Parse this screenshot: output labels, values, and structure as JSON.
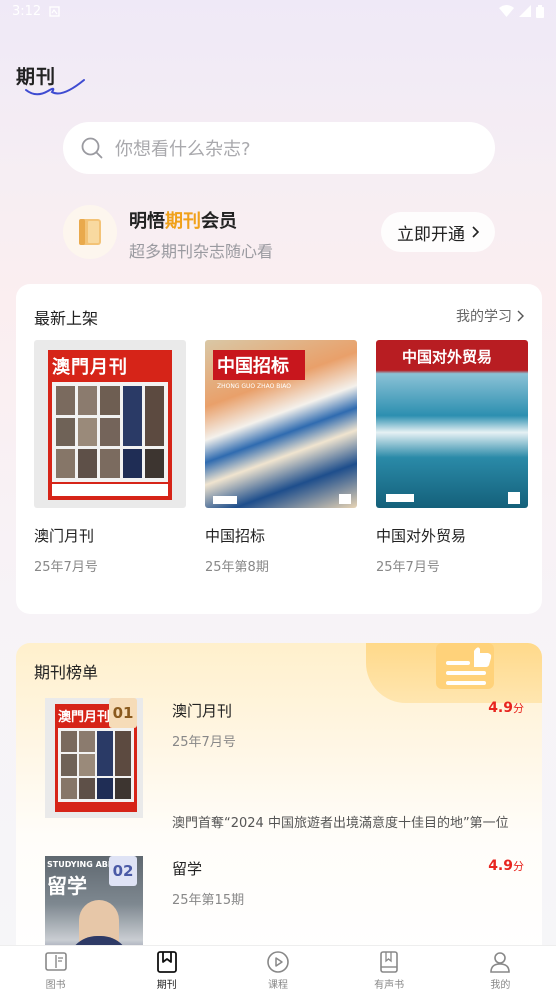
{
  "status": {
    "time": "3:12"
  },
  "page": {
    "title": "期刊"
  },
  "search": {
    "placeholder": "你想看什么杂志?"
  },
  "member": {
    "title_prefix": "明悟",
    "title_highlight": "期刊",
    "title_suffix": "会员",
    "subtitle": "超多期刊杂志随心看",
    "button": "立即开通"
  },
  "latest": {
    "title": "最新上架",
    "link": "我的学习",
    "items": [
      {
        "name": "澳门月刊",
        "issue": "25年7月号",
        "cover_title": "澳門月刊"
      },
      {
        "name": "中国招标",
        "issue": "25年第8期",
        "cover_title": "中国招标",
        "cover_sub": "ZHONG GUO ZHAO BIAO"
      },
      {
        "name": "中国对外贸易",
        "issue": "25年7月号",
        "cover_title": "中国对外贸易"
      }
    ]
  },
  "ranking": {
    "title": "期刊榜单",
    "items": [
      {
        "rank": "01",
        "name": "澳门月刊",
        "issue": "25年7月号",
        "score": "4.9",
        "unit": "分",
        "desc": "澳門首奪“2024 中国旅遊者出境滿意度十佳目的地”第一位",
        "cover_title": "澳門月刊"
      },
      {
        "rank": "02",
        "name": "留学",
        "issue": "25年第15期",
        "score": "4.9",
        "unit": "分",
        "cover_title": "留学",
        "cover_sub": "STUDYING ABROAD"
      }
    ]
  },
  "tabs": [
    {
      "label": "图书",
      "icon": "book-icon"
    },
    {
      "label": "期刊",
      "icon": "bookmark-icon"
    },
    {
      "label": "课程",
      "icon": "play-icon"
    },
    {
      "label": "有声书",
      "icon": "audiobook-icon"
    },
    {
      "label": "我的",
      "icon": "user-icon"
    }
  ],
  "colors": {
    "accent": "#f0a11a",
    "score": "#e8251f",
    "rank_badge_1": "#f6dcb8",
    "rank_badge_2": "#dfe3f5"
  }
}
